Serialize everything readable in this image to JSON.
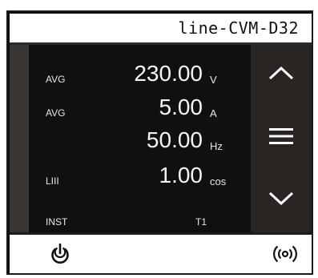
{
  "header": {
    "device_name": "line-CVM-D32"
  },
  "readings": [
    {
      "label": "AVG",
      "value": "230.00",
      "unit": "V"
    },
    {
      "label": "AVG",
      "value": "5.00",
      "unit": "A"
    },
    {
      "label": "",
      "value": "50.00",
      "unit": "Hz"
    },
    {
      "label": "LIII",
      "value": "1.00",
      "unit": "cos"
    }
  ],
  "footer": {
    "mode": "INST",
    "tariff": "T1"
  },
  "icons": {
    "up": "chevron-up-icon",
    "menu": "hamburger-menu-icon",
    "down": "chevron-down-icon",
    "power": "power-icon",
    "wireless": "wireless-signal-icon"
  },
  "colors": {
    "screen_bg": "#101010",
    "side_panel": "#2a2522",
    "text": "#f5f5f5"
  }
}
